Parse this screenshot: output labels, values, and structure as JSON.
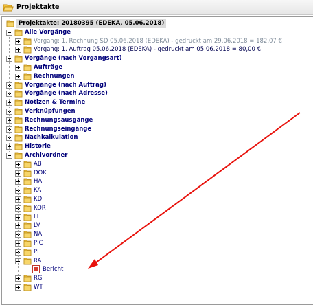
{
  "window": {
    "title": "Projektakte"
  },
  "tree": {
    "root": "Projektakte: 20180395 (EDEKA, 05.06.2018)",
    "alle_vorgaenge": "Alle Vorgänge",
    "vorgang_1": "Vorgang: 1. Rechnung SD 05.06.2018 (EDEKA) - gedruckt am 29.06.2018 = 182,07 €",
    "vorgang_2": "Vorgang: 1. Auftrag 05.06.2018 (EDEKA) - gedruckt am 05.06.2018 = 80,00 €",
    "vorgaenge_vorgangsart": "Vorgänge (nach Vorgangsart)",
    "auftraege": "Aufträge",
    "rechnungen": "Rechnungen",
    "vorgaenge_auftrag": "Vorgänge (nach Auftrag)",
    "vorgaenge_adresse": "Vorgänge (nach Adresse)",
    "notizen": "Notizen & Termine",
    "verknuepfungen": "Verknüpfungen",
    "rechnungsausgaenge": "Rechnungsausgänge",
    "rechnungseingaenge": "Rechnungseingänge",
    "nachkalkulation": "Nachkalkulation",
    "historie": "Historie",
    "archivordner": "Archivordner",
    "archive_folders": [
      "AB",
      "DOK",
      "HA",
      "KA",
      "KD",
      "KOR",
      "LI",
      "LV",
      "NA",
      "PIC",
      "PL",
      "RA"
    ],
    "bericht": "Bericht",
    "after_folders": [
      "RG",
      "WT"
    ]
  },
  "annotation": {
    "arrow_color": "#e8120c"
  }
}
